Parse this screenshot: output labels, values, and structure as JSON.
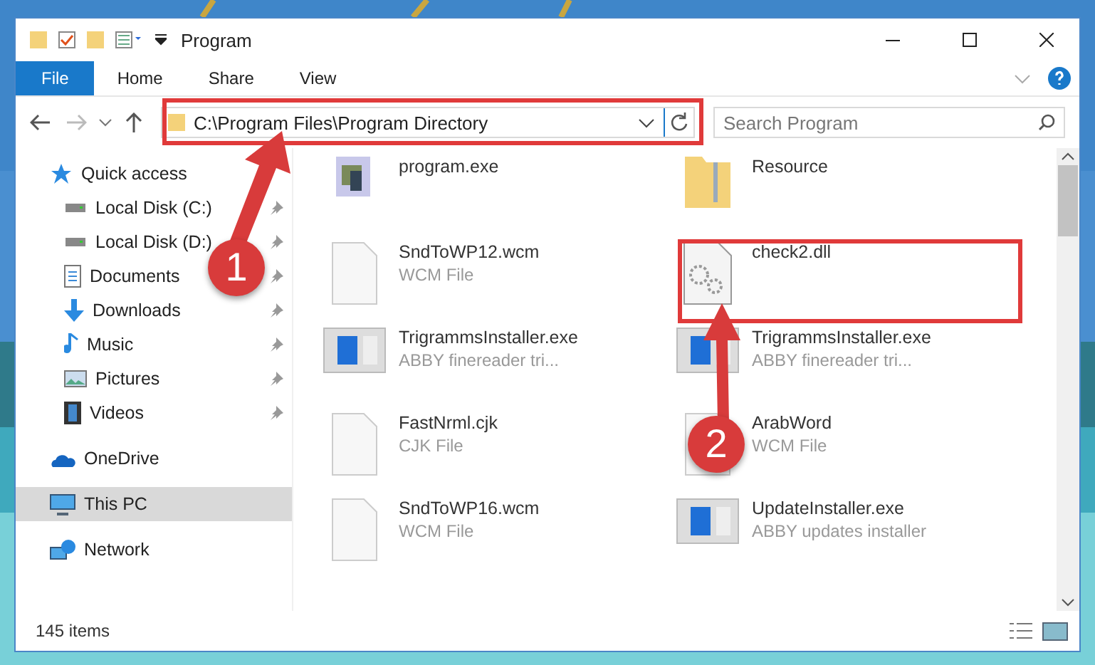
{
  "window": {
    "title": "Program"
  },
  "ribbon_tabs": [
    {
      "label": "File",
      "selected": true
    },
    {
      "label": "Home",
      "selected": false
    },
    {
      "label": "Share",
      "selected": false
    },
    {
      "label": "View",
      "selected": false
    }
  ],
  "address": {
    "value": "C:\\Program Files\\Program Directory"
  },
  "search": {
    "placeholder": "Search Program"
  },
  "sidebar": {
    "items": [
      {
        "label": "Quick access",
        "selected": false,
        "children": [
          {
            "label": "Local Disk (C:)",
            "pinned": true,
            "selected": false
          },
          {
            "label": "Local Disk (D:)",
            "pinned": true,
            "selected": false
          },
          {
            "label": "Documents",
            "pinned": true,
            "selected": false
          },
          {
            "label": "Downloads",
            "pinned": true,
            "selected": false
          },
          {
            "label": "Music",
            "pinned": true,
            "selected": false
          },
          {
            "label": "Pictures",
            "pinned": true,
            "selected": false
          },
          {
            "label": "Videos",
            "pinned": true,
            "selected": false
          }
        ]
      },
      {
        "label": "OneDrive",
        "selected": false
      },
      {
        "label": "This PC",
        "selected": true
      },
      {
        "label": "Network",
        "selected": false
      }
    ]
  },
  "files": [
    {
      "name": "program.exe"
    },
    {
      "name": "Resource"
    },
    {
      "name": "SndToWP12.wcm",
      "type": "WCM File"
    },
    {
      "name": "check2.dll"
    },
    {
      "name": "TrigrammsInstaller.exe",
      "type": "ABBY finereader tri..."
    },
    {
      "name": "TrigrammsInstaller.exe",
      "type": "ABBY finereader tri..."
    },
    {
      "name": "FastNrml.cjk",
      "type": "CJK File"
    },
    {
      "name": "ArabWord",
      "type": "WCM File"
    },
    {
      "name": "SndToWP16.wcm",
      "type": "WCM File"
    },
    {
      "name": "UpdateInstaller.exe",
      "type": "ABBY updates installer"
    }
  ],
  "status_bar": {
    "count": "145 items"
  },
  "annotations": [
    {
      "label": "1"
    },
    {
      "label": "2"
    }
  ]
}
